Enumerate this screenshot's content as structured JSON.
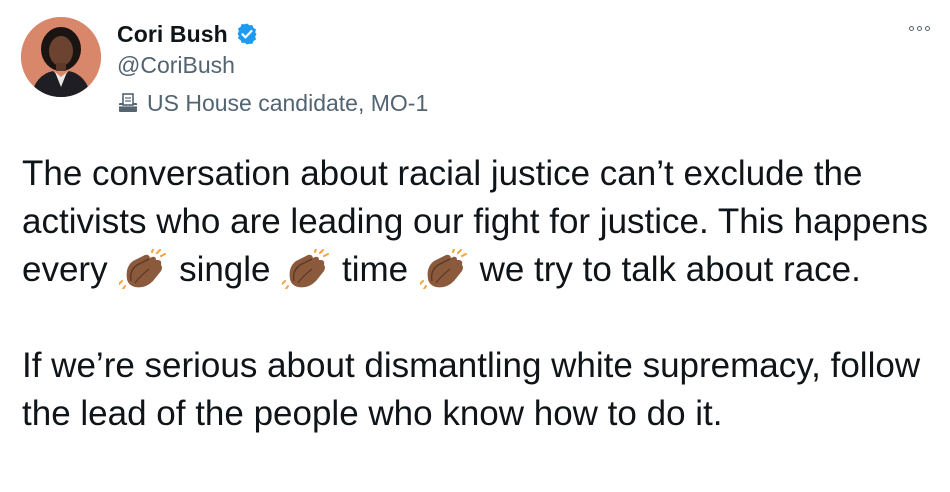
{
  "author": {
    "display_name": "Cori Bush",
    "verified": true,
    "handle": "@CoriBush",
    "label": "US House candidate, MO-1",
    "label_icon": "ballot-box-icon"
  },
  "menu": {
    "icon": "more-icon"
  },
  "tweet": {
    "line1": "The conversation about racial justice can’t exclude the activists who are leading our fight for justice. This happens every",
    "word_single": "single",
    "word_time": "time",
    "line_end": "we try to talk about race.",
    "paragraph2": "If we’re serious about dismantling white supremacy, follow the lead of the people who know how to do it.",
    "emoji": "clapping-hands-medium-dark-skin"
  },
  "colors": {
    "text_primary": "#0f1419",
    "text_secondary": "#536471",
    "verified_blue": "#1d9bf0",
    "avatar_bg": "#d9876a"
  }
}
